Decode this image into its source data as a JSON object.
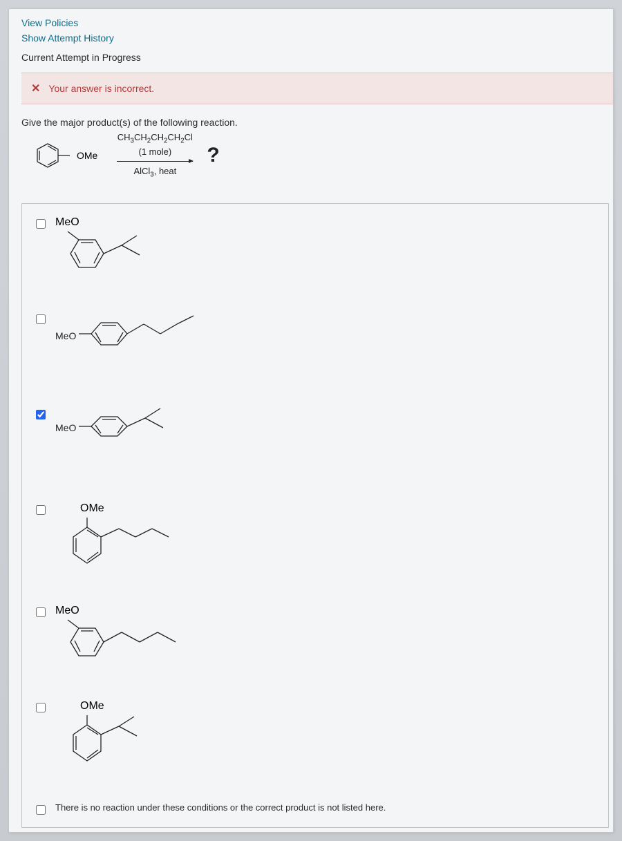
{
  "links": {
    "view_policies": "View Policies",
    "show_attempt": "Show Attempt History"
  },
  "status": "Current Attempt in Progress",
  "alert": {
    "icon": "x-icon",
    "text": "Your answer is incorrect."
  },
  "question": {
    "prompt": "Give the major product(s) of the following reaction.",
    "starting_label": "OMe",
    "reagent_top_html": "CH<sub>3</sub>CH<sub>2</sub>CH<sub>2</sub>CH<sub>2</sub>Cl",
    "reagent_mid": "(1 mole)",
    "reagent_bottom_html": "AlCl<sub>3</sub>, heat",
    "product_mark": "?"
  },
  "options": [
    {
      "label": "MeO",
      "checked": false,
      "correct": false
    },
    {
      "label": "MeO",
      "checked": false,
      "correct": false
    },
    {
      "label": "MeO",
      "checked": true,
      "correct": true
    },
    {
      "label": "OMe",
      "checked": false,
      "correct": false
    },
    {
      "label": "MeO",
      "checked": false,
      "correct": false
    },
    {
      "label": "OMe",
      "checked": false,
      "correct": false
    }
  ],
  "no_reaction": "There is no reaction under these conditions or the correct product is not listed here."
}
